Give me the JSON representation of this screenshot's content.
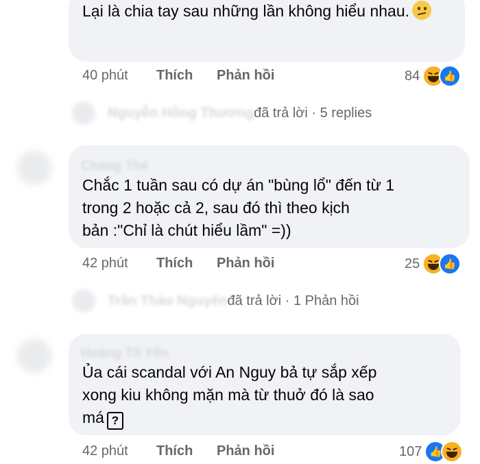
{
  "comments": [
    {
      "text": "Lại là chia tay sau những lần không hiểu nhau.",
      "emoji": "confused-face",
      "time": "40 phút",
      "like_label": "Thích",
      "reply_label": "Phản hồi",
      "reaction_count": "84",
      "reactions": [
        "haha",
        "like"
      ],
      "replies_text": "đã trả lời · 5 replies"
    },
    {
      "author": "Chang Thẻ",
      "text_lines": [
        "Chắc 1 tuần sau có dự án \"bùng lổ\" đến từ 1",
        "trong 2 hoặc cả 2, sau đó thì theo kịch",
        "bản :\"Chỉ là chút hiểu lầm\" =))"
      ],
      "time": "42 phút",
      "like_label": "Thích",
      "reply_label": "Phản hồi",
      "reaction_count": "25",
      "reactions": [
        "haha",
        "like"
      ],
      "replies_text": "đã trả lời · 1 Phản hồi"
    },
    {
      "author": "Hoàng Tố Yến",
      "text_lines": [
        "Ủa cái scandal với An Nguy bả tự sắp xếp",
        "xong kiu không mặn mà từ thuở đó là sao",
        "má"
      ],
      "emoji": "question-box",
      "emoji_char": "?",
      "time": "42 phút",
      "like_label": "Thích",
      "reply_label": "Phản hồi",
      "reaction_count": "107",
      "reactions": [
        "like",
        "haha"
      ]
    }
  ]
}
